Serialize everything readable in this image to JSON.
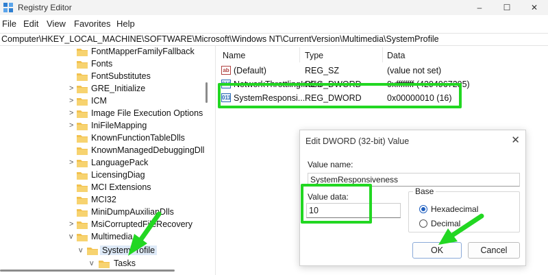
{
  "window": {
    "title": "Registry Editor",
    "minimize": "–",
    "maximize": "☐",
    "close": "✕"
  },
  "menu": [
    "File",
    "Edit",
    "View",
    "Favorites",
    "Help"
  ],
  "address": "Computer\\HKEY_LOCAL_MACHINE\\SOFTWARE\\Microsoft\\Windows NT\\CurrentVersion\\Multimedia\\SystemProfile",
  "tree": [
    {
      "label": "FontMapperFamilyFallback",
      "chevron": "",
      "indent": 0
    },
    {
      "label": "Fonts",
      "chevron": "",
      "indent": 0
    },
    {
      "label": "FontSubstitutes",
      "chevron": "",
      "indent": 0
    },
    {
      "label": "GRE_Initialize",
      "chevron": ">",
      "indent": 0
    },
    {
      "label": "ICM",
      "chevron": ">",
      "indent": 0
    },
    {
      "label": "Image File Execution Options",
      "chevron": ">",
      "indent": 0
    },
    {
      "label": "IniFileMapping",
      "chevron": ">",
      "indent": 0
    },
    {
      "label": "KnownFunctionTableDlls",
      "chevron": "",
      "indent": 0
    },
    {
      "label": "KnownManagedDebuggingDll",
      "chevron": "",
      "indent": 0
    },
    {
      "label": "LanguagePack",
      "chevron": ">",
      "indent": 0
    },
    {
      "label": "LicensingDiag",
      "chevron": "",
      "indent": 0
    },
    {
      "label": "MCI Extensions",
      "chevron": "",
      "indent": 0
    },
    {
      "label": "MCI32",
      "chevron": "",
      "indent": 0
    },
    {
      "label": "MiniDumpAuxilianDlls",
      "chevron": "",
      "indent": 0
    },
    {
      "label": "MsiCorruptedFileRecovery",
      "chevron": ">",
      "indent": 0
    },
    {
      "label": "Multimedia",
      "chevron": "v",
      "indent": 0
    },
    {
      "label": "SystemProfile",
      "chevron": "v",
      "indent": 1,
      "selected": true
    },
    {
      "label": "Tasks",
      "chevron": "v",
      "indent": 2
    }
  ],
  "list": {
    "headers": {
      "name": "Name",
      "type": "Type",
      "data": "Data"
    },
    "rows": [
      {
        "icon": "ab",
        "name": "(Default)",
        "type": "REG_SZ",
        "data": "(value not set)"
      },
      {
        "icon": "011",
        "name": "NetworkThrottlingIndex",
        "type": "REG_DWORD",
        "data": "0xffffffff (4294967295)"
      },
      {
        "icon": "011",
        "name": "SystemResponsi...",
        "type": "REG_DWORD",
        "data": "0x00000010 (16)"
      }
    ]
  },
  "dialog": {
    "title": "Edit DWORD (32-bit) Value",
    "close": "✕",
    "value_name_label": "Value name:",
    "value_name": "SystemResponsiveness",
    "value_data_label": "Value data:",
    "value_data": "10",
    "base_label": "Base",
    "hex_label": "Hexadecimal",
    "dec_label": "Decimal",
    "base_selected": "Hexadecimal",
    "ok": "OK",
    "cancel": "Cancel"
  },
  "colors": {
    "highlight": "#22d722",
    "folder": "#f2c14e",
    "selection": "#dde9f7"
  }
}
